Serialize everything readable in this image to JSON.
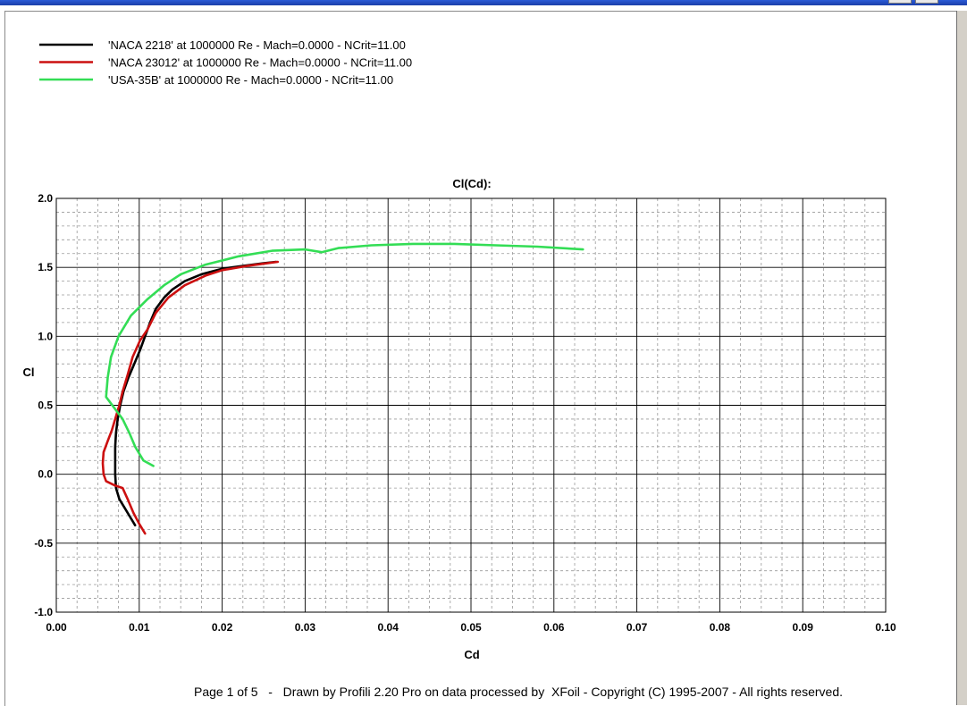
{
  "chart_data": {
    "type": "line",
    "title": "Cl(Cd):",
    "xlabel": "Cd",
    "ylabel": "Cl",
    "xlim": [
      0.0,
      0.1
    ],
    "ylim": [
      -1.0,
      2.0
    ],
    "x_ticks": [
      "0.00",
      "0.01",
      "0.02",
      "0.03",
      "0.04",
      "0.05",
      "0.06",
      "0.07",
      "0.08",
      "0.09",
      "0.10"
    ],
    "y_ticks": [
      "2.0",
      "1.5",
      "1.0",
      "0.5",
      "0.0",
      "-0.5",
      "-1.0"
    ],
    "grid": true,
    "legend_position": "top-left",
    "series": [
      {
        "name": "'NACA 2218' at 1000000 Re - Mach=0.0000 - NCrit=11.00",
        "color": "#000000",
        "points": [
          [
            0.0095,
            -0.37
          ],
          [
            0.0088,
            -0.3
          ],
          [
            0.0082,
            -0.24
          ],
          [
            0.0076,
            -0.18
          ],
          [
            0.0072,
            -0.1
          ],
          [
            0.0071,
            0.0
          ],
          [
            0.0071,
            0.1
          ],
          [
            0.0071,
            0.2
          ],
          [
            0.0072,
            0.3
          ],
          [
            0.0074,
            0.4
          ],
          [
            0.0077,
            0.5
          ],
          [
            0.0081,
            0.6
          ],
          [
            0.0087,
            0.7
          ],
          [
            0.0094,
            0.8
          ],
          [
            0.0101,
            0.9
          ],
          [
            0.0107,
            1.0
          ],
          [
            0.0113,
            1.1
          ],
          [
            0.012,
            1.2
          ],
          [
            0.013,
            1.28
          ],
          [
            0.014,
            1.34
          ],
          [
            0.0155,
            1.4
          ],
          [
            0.0175,
            1.45
          ],
          [
            0.02,
            1.49
          ],
          [
            0.0225,
            1.51
          ],
          [
            0.025,
            1.53
          ],
          [
            0.0265,
            1.54
          ]
        ]
      },
      {
        "name": "'NACA 23012' at 1000000 Re - Mach=0.0000 - NCrit=11.00",
        "color": "#cc1010",
        "points": [
          [
            0.0107,
            -0.43
          ],
          [
            0.01,
            -0.36
          ],
          [
            0.0093,
            -0.28
          ],
          [
            0.0086,
            -0.18
          ],
          [
            0.008,
            -0.1
          ],
          [
            0.007,
            -0.08
          ],
          [
            0.006,
            -0.05
          ],
          [
            0.0057,
            0.0
          ],
          [
            0.0056,
            0.08
          ],
          [
            0.0057,
            0.16
          ],
          [
            0.0062,
            0.24
          ],
          [
            0.0067,
            0.32
          ],
          [
            0.0071,
            0.4
          ],
          [
            0.0076,
            0.5
          ],
          [
            0.008,
            0.6
          ],
          [
            0.0086,
            0.72
          ],
          [
            0.0092,
            0.85
          ],
          [
            0.0101,
            0.97
          ],
          [
            0.011,
            1.05
          ],
          [
            0.012,
            1.17
          ],
          [
            0.0135,
            1.28
          ],
          [
            0.0155,
            1.37
          ],
          [
            0.018,
            1.44
          ],
          [
            0.02,
            1.48
          ],
          [
            0.023,
            1.51
          ],
          [
            0.0267,
            1.54
          ]
        ]
      },
      {
        "name": "'USA-35B' at 1000000 Re - Mach=0.0000 - NCrit=11.00",
        "color": "#33dd55",
        "points": [
          [
            0.0117,
            0.06
          ],
          [
            0.0105,
            0.1
          ],
          [
            0.0095,
            0.2
          ],
          [
            0.0088,
            0.3
          ],
          [
            0.008,
            0.4
          ],
          [
            0.007,
            0.48
          ],
          [
            0.006,
            0.56
          ],
          [
            0.0062,
            0.7
          ],
          [
            0.0066,
            0.85
          ],
          [
            0.0075,
            1.0
          ],
          [
            0.009,
            1.15
          ],
          [
            0.011,
            1.27
          ],
          [
            0.013,
            1.37
          ],
          [
            0.015,
            1.45
          ],
          [
            0.018,
            1.52
          ],
          [
            0.022,
            1.58
          ],
          [
            0.026,
            1.62
          ],
          [
            0.03,
            1.63
          ],
          [
            0.032,
            1.61
          ],
          [
            0.034,
            1.64
          ],
          [
            0.038,
            1.66
          ],
          [
            0.043,
            1.67
          ],
          [
            0.048,
            1.67
          ],
          [
            0.053,
            1.66
          ],
          [
            0.058,
            1.65
          ],
          [
            0.0635,
            1.63
          ]
        ]
      }
    ]
  },
  "footer": "Page 1 of 5   -   Drawn by Profili 2.20 Pro on data processed by  XFoil - Copyright (C) 1995-2007 - All rights reserved."
}
